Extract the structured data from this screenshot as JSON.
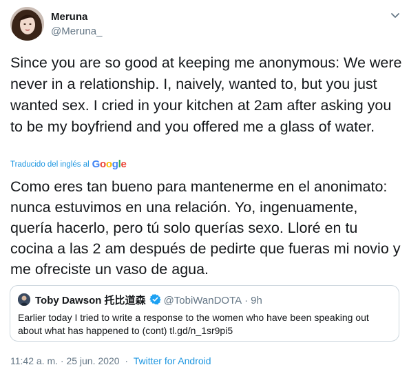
{
  "author": {
    "name": "Meruna",
    "handle": "@Meruna_"
  },
  "tweet": {
    "text": "Since you are so good at keeping me anonymous: We were never in a relationship. I, naively, wanted to, but you just wanted sex. I cried in your kitchen at 2am after asking you to be my boyfriend and you offered me a glass of water.",
    "translated_by": "Traducido del inglés al",
    "translator_logo_text": "Google",
    "translated_text": "Como eres tan bueno para mantenerme en el anonimato: nunca estuvimos en una relación. Yo, ingenuamente, quería hacerlo, pero tú solo querías sexo. Lloré en tu cocina a las 2 am después de pedirte que fueras mi novio y me ofreciste un vaso de agua."
  },
  "quoted_tweet": {
    "name": "Toby Dawson 托比道森",
    "handle": "@TobiWanDOTA",
    "separator": "·",
    "time": "9h",
    "text": "Earlier today I tried to write a response to the women who have been speaking out about what has happened to (cont) tl.gd/n_1sr9pi5"
  },
  "footer": {
    "timestamp": "11:42 a. m. · 25 jun. 2020",
    "separator": "·",
    "source": "Twitter for Android"
  },
  "colors": {
    "link": "#1b95e0",
    "secondary_text": "#657786",
    "border": "#ccd6dd",
    "verified": "#1da1f2"
  },
  "icons": {
    "caret": "chevron-down-icon",
    "verified": "verified-badge-icon"
  }
}
